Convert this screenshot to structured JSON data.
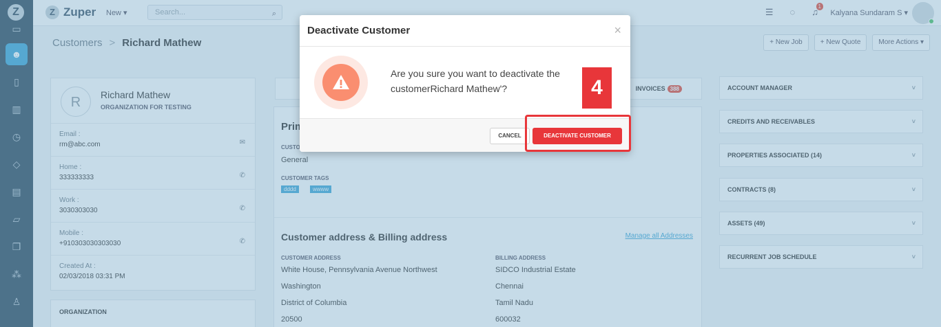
{
  "sidebar": {
    "logo": "Z",
    "icons": [
      "calendar-icon",
      "users-icon",
      "file-icon",
      "map-icon",
      "clock-icon",
      "tag-icon",
      "invoice-icon",
      "folder-icon",
      "documents-icon",
      "network-icon",
      "person-icon"
    ]
  },
  "topbar": {
    "brand_mark": "Z",
    "brand_name": "Zuper",
    "new_label": "New ▾",
    "search_placeholder": "Search...",
    "notification_count": "1",
    "user_name": "Kalyana Sundaram S ▾"
  },
  "breadcrumb": {
    "parent": "Customers",
    "separator": ">",
    "current": "Richard Mathew"
  },
  "actions": {
    "new_job": "+ New Job",
    "new_quote": "+ New Quote",
    "more_actions": "More Actions ▾"
  },
  "customer": {
    "initial": "R",
    "name": "Richard Mathew",
    "organization": "ORGANIZATION FOR TESTING",
    "fields": [
      {
        "label": "Email :",
        "value": "rm@abc.com"
      },
      {
        "label": "Home :",
        "value": "333333333"
      },
      {
        "label": "Work :",
        "value": "3030303030"
      },
      {
        "label": "Mobile :",
        "value": "+910303030303030"
      },
      {
        "label": "Created At :",
        "value": "02/03/2018 03:31 PM"
      }
    ],
    "org_section_title": "ORGANIZATION"
  },
  "tabs": {
    "invoices_label": "INVOICES",
    "invoices_count": "388"
  },
  "details": {
    "section_title": "Prim",
    "category_label": "CUSTO",
    "category_value": "General",
    "tags_label": "CUSTOMER TAGS",
    "tags": [
      "dddd",
      "wwww"
    ],
    "address_title": "Customer address & Billing address",
    "manage_link": "Manage all Addresses",
    "customer_address_label": "CUSTOMER ADDRESS",
    "billing_address_label": "BILLING ADDRESS",
    "customer_address": [
      "White House, Pennsylvania Avenue Northwest",
      "Washington",
      "District of Columbia",
      "20500"
    ],
    "billing_address": [
      "SIDCO Industrial Estate",
      "Chennai",
      "Tamil Nadu",
      "600032"
    ]
  },
  "right_panel": [
    "ACCOUNT MANAGER",
    "CREDITS AND RECEIVABLES",
    "PROPERTIES ASSOCIATED (14)",
    "CONTRACTS (8)",
    "ASSETS (49)",
    "RECURRENT JOB SCHEDULE"
  ],
  "modal": {
    "title": "Deactivate Customer",
    "close": "×",
    "message": "Are you sure you want to deactivate the customerRichard Mathew'?",
    "step_number": "4",
    "cancel_label": "CANCEL",
    "confirm_label": "DEACTIVATE CUSTOMER"
  }
}
